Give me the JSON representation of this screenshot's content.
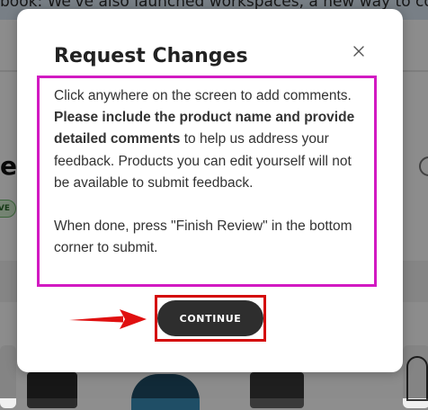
{
  "background": {
    "banner_text": "book: We've also launched workspaces, a new way to collaborate w",
    "heading_fragment": "e",
    "badge_text": "VE"
  },
  "modal": {
    "title": "Request Changes",
    "close_label": "×",
    "body": {
      "intro": "Click anywhere on the screen to add comments. ",
      "emphasis": "Please include the product name and provide detailed comments",
      "rest": " to help us address your feedback. Products you can edit yourself will not be available to submit feedback.",
      "second_paragraph": "When done, press \"Finish Review\" in the bottom corner to submit."
    },
    "continue_label": "CONTINUE"
  },
  "annotations": {
    "text_box_color": "#d21ac2",
    "button_box_color": "#d40a0a",
    "arrow_color": "#e01010"
  },
  "colors": {
    "button_bg": "#2e2e2e",
    "button_text": "#ffffff"
  }
}
